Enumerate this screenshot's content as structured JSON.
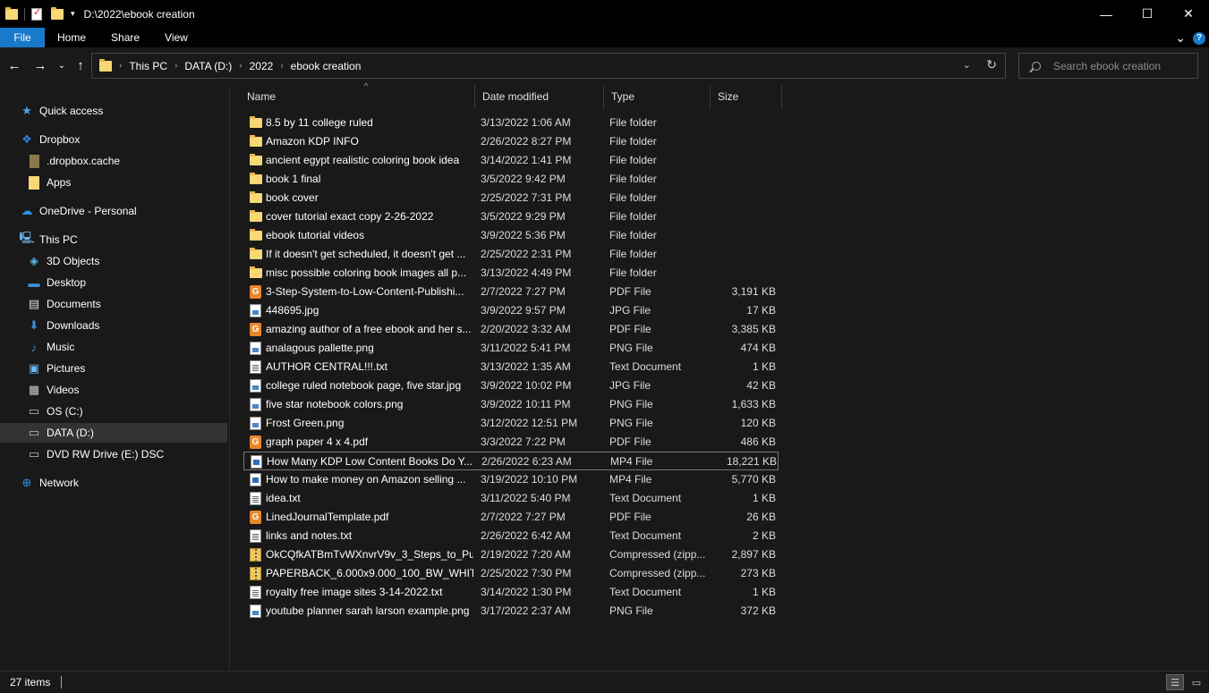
{
  "window": {
    "title": "D:\\2022\\ebook creation",
    "controls": {
      "minimize": "—",
      "maximize": "☐",
      "close": "✕"
    }
  },
  "ribbon": {
    "tabs": [
      "File",
      "Home",
      "Share",
      "View"
    ],
    "expand_icon": "⌄",
    "help_icon": "?"
  },
  "address_bar": {
    "breadcrumbs": [
      "This PC",
      "DATA (D:)",
      "2022",
      "ebook creation"
    ],
    "separator": "›"
  },
  "search": {
    "placeholder": "Search ebook creation"
  },
  "sidebar": {
    "items": [
      {
        "label": "Quick access",
        "icon": "star-icon"
      },
      {
        "label": "Dropbox",
        "icon": "dropbox-icon"
      },
      {
        "label": ".dropbox.cache",
        "icon": "folder-icon"
      },
      {
        "label": "Apps",
        "icon": "folder-icon"
      },
      {
        "label": "OneDrive - Personal",
        "icon": "cloud-icon"
      },
      {
        "label": "This PC",
        "icon": "computer-icon"
      },
      {
        "label": "3D Objects",
        "icon": "cube-icon"
      },
      {
        "label": "Desktop",
        "icon": "desktop-icon"
      },
      {
        "label": "Documents",
        "icon": "documents-icon"
      },
      {
        "label": "Downloads",
        "icon": "download-icon"
      },
      {
        "label": "Music",
        "icon": "music-icon"
      },
      {
        "label": "Pictures",
        "icon": "pictures-icon"
      },
      {
        "label": "Videos",
        "icon": "videos-icon"
      },
      {
        "label": "OS (C:)",
        "icon": "drive-icon"
      },
      {
        "label": "DATA (D:)",
        "icon": "drive-icon"
      },
      {
        "label": "DVD RW Drive (E:) DSC",
        "icon": "dvd-drive-icon"
      },
      {
        "label": "Network",
        "icon": "network-icon"
      }
    ]
  },
  "columns": [
    "Name",
    "Date modified",
    "Type",
    "Size"
  ],
  "files": [
    {
      "name": "8.5 by 11 college ruled",
      "date": "3/13/2022 1:06 AM",
      "type": "File folder",
      "size": "",
      "icon": "folder"
    },
    {
      "name": "Amazon KDP INFO",
      "date": "2/26/2022 8:27 PM",
      "type": "File folder",
      "size": "",
      "icon": "folder"
    },
    {
      "name": "ancient egypt realistic coloring book idea",
      "date": "3/14/2022 1:41 PM",
      "type": "File folder",
      "size": "",
      "icon": "folder"
    },
    {
      "name": "book 1 final",
      "date": "3/5/2022 9:42 PM",
      "type": "File folder",
      "size": "",
      "icon": "folder"
    },
    {
      "name": "book cover",
      "date": "2/25/2022 7:31 PM",
      "type": "File folder",
      "size": "",
      "icon": "folder"
    },
    {
      "name": "cover tutorial exact copy 2-26-2022",
      "date": "3/5/2022 9:29 PM",
      "type": "File folder",
      "size": "",
      "icon": "folder"
    },
    {
      "name": "ebook tutorial videos",
      "date": "3/9/2022 5:36 PM",
      "type": "File folder",
      "size": "",
      "icon": "folder"
    },
    {
      "name": "If it doesn't get scheduled, it doesn't get ...",
      "date": "2/25/2022 2:31 PM",
      "type": "File folder",
      "size": "",
      "icon": "folder"
    },
    {
      "name": "misc possible coloring book images all p...",
      "date": "3/13/2022 4:49 PM",
      "type": "File folder",
      "size": "",
      "icon": "folder"
    },
    {
      "name": "3-Step-System-to-Low-Content-Publishi...",
      "date": "2/7/2022 7:27 PM",
      "type": "PDF File",
      "size": "3,191 KB",
      "icon": "pdf"
    },
    {
      "name": "448695.jpg",
      "date": "3/9/2022 9:57 PM",
      "type": "JPG File",
      "size": "17 KB",
      "icon": "img"
    },
    {
      "name": "amazing author of a free ebook and her s...",
      "date": "2/20/2022 3:32 AM",
      "type": "PDF File",
      "size": "3,385 KB",
      "icon": "pdf"
    },
    {
      "name": "analagous pallette.png",
      "date": "3/11/2022 5:41 PM",
      "type": "PNG File",
      "size": "474 KB",
      "icon": "img"
    },
    {
      "name": "AUTHOR CENTRAL!!!.txt",
      "date": "3/13/2022 1:35 AM",
      "type": "Text Document",
      "size": "1 KB",
      "icon": "doc"
    },
    {
      "name": "college ruled notebook page, five star.jpg",
      "date": "3/9/2022 10:02 PM",
      "type": "JPG File",
      "size": "42 KB",
      "icon": "img"
    },
    {
      "name": "five star notebook colors.png",
      "date": "3/9/2022 10:11 PM",
      "type": "PNG File",
      "size": "1,633 KB",
      "icon": "img"
    },
    {
      "name": "Frost Green.png",
      "date": "3/12/2022 12:51 PM",
      "type": "PNG File",
      "size": "120 KB",
      "icon": "img"
    },
    {
      "name": "graph paper 4 x 4.pdf",
      "date": "3/3/2022 7:22 PM",
      "type": "PDF File",
      "size": "486 KB",
      "icon": "pdf"
    },
    {
      "name": "How Many KDP Low Content Books Do Y...",
      "date": "2/26/2022 6:23 AM",
      "type": "MP4 File",
      "size": "18,221 KB",
      "icon": "vid"
    },
    {
      "name": "How to make money on Amazon selling ...",
      "date": "3/19/2022 10:10 PM",
      "type": "MP4 File",
      "size": "5,770 KB",
      "icon": "vid"
    },
    {
      "name": "idea.txt",
      "date": "3/11/2022 5:40 PM",
      "type": "Text Document",
      "size": "1 KB",
      "icon": "doc"
    },
    {
      "name": "LinedJournalTemplate.pdf",
      "date": "2/7/2022 7:27 PM",
      "type": "PDF File",
      "size": "26 KB",
      "icon": "pdf"
    },
    {
      "name": "links and notes.txt",
      "date": "2/26/2022 6:42 AM",
      "type": "Text Document",
      "size": "2 KB",
      "icon": "doc"
    },
    {
      "name": "OkCQfkATBmTvWXnvrV9v_3_Steps_to_Pu...",
      "date": "2/19/2022 7:20 AM",
      "type": "Compressed (zipp...",
      "size": "2,897 KB",
      "icon": "zip"
    },
    {
      "name": "PAPERBACK_6.000x9.000_100_BW_WHITE...",
      "date": "2/25/2022 7:30 PM",
      "type": "Compressed (zipp...",
      "size": "273 KB",
      "icon": "zip"
    },
    {
      "name": "royalty free image sites 3-14-2022.txt",
      "date": "3/14/2022 1:30 PM",
      "type": "Text Document",
      "size": "1 KB",
      "icon": "doc"
    },
    {
      "name": "youtube planner sarah larson example.png",
      "date": "3/17/2022 2:37 AM",
      "type": "PNG File",
      "size": "372 KB",
      "icon": "img"
    }
  ],
  "status": {
    "item_count": "27 items"
  },
  "colors": {
    "accent": "#1979ca",
    "folder": "#f8d775",
    "pdf": "#e8862a",
    "background": "#191919"
  }
}
